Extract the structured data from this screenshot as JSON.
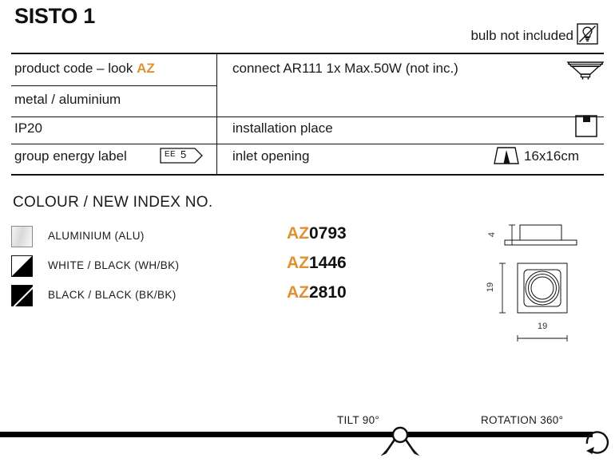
{
  "header": {
    "title": "SISTO 1",
    "bulb_note": "bulb not included",
    "bulb_icon": "bulb-crossed-out-icon"
  },
  "spec_table": {
    "left_column": [
      {
        "label": "product code – look ",
        "accent": "AZ",
        "accent_color": "#E0912F"
      },
      {
        "label": "metal / aluminium",
        "accent": "",
        "accent_color": ""
      },
      {
        "label": "IP20",
        "accent": "",
        "accent_color": ""
      },
      {
        "label": "group energy label",
        "accent": "",
        "accent_color": ""
      }
    ],
    "energy_label": {
      "prefix": "EE",
      "value": "5",
      "icon": "energy-pennant-icon"
    },
    "right_column": [
      {
        "label": "connect AR111 1x Max.50W (not inc.)",
        "icon": "ar111-lamp-icon",
        "value": ""
      },
      {
        "label": "installation place",
        "icon": "recessed-ceiling-icon",
        "value": ""
      },
      {
        "label": "inlet opening",
        "icon": "inlet-trapezoid-icon",
        "value": "16x16cm"
      }
    ]
  },
  "colour_section": {
    "heading": "COLOUR / NEW INDEX NO.",
    "rows": [
      {
        "swatch": "aluminium-swatch",
        "name": "ALUMINIUM (ALU)",
        "leader": ". . . . . . . . . .",
        "code_prefix": "AZ",
        "code_number": "0793"
      },
      {
        "swatch": "white-black-swatch",
        "name": "WHITE / BLACK (WH/BK)",
        "leader": ". . . . . .",
        "code_prefix": "AZ",
        "code_number": "1446"
      },
      {
        "swatch": "black-black-swatch",
        "name": "BLACK / BLACK (BK/BK)",
        "leader": ". . . . . .",
        "code_prefix": "AZ",
        "code_number": "2810"
      }
    ],
    "accent_color": "#E0912F"
  },
  "tech_drawing": {
    "height_dim": "4",
    "side_dim": "19",
    "width_dim": "19",
    "side_view_icon": "luminaire-side-view-icon",
    "top_view_icon": "luminaire-top-view-icon"
  },
  "motion": {
    "tilt_label": "TILT 90°",
    "rotation_label": "ROTATION 360°",
    "tilt_icon": "tilt-arrows-icon",
    "rotation_icon": "rotation-circle-arrow-icon"
  }
}
